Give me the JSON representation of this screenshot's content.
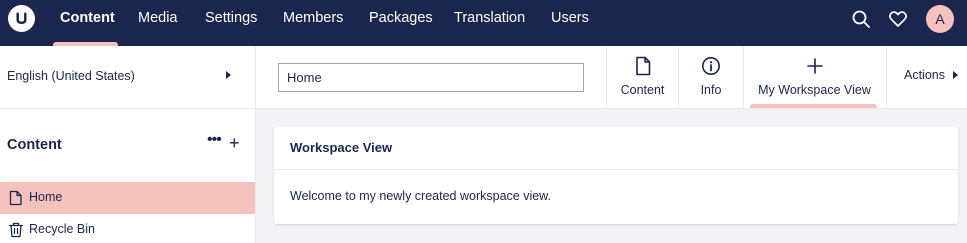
{
  "nav": {
    "items": [
      {
        "label": "Content",
        "active": true
      },
      {
        "label": "Media"
      },
      {
        "label": "Settings"
      },
      {
        "label": "Members"
      },
      {
        "label": "Packages"
      },
      {
        "label": "Translation"
      },
      {
        "label": "Users"
      }
    ],
    "avatar_initial": "A",
    "icons": [
      "umbraco-logo-icon",
      "search-icon",
      "heart-icon"
    ]
  },
  "header": {
    "language": "English (United States)",
    "node_name": "Home",
    "apps": [
      {
        "label": "Content",
        "icon": "document-icon"
      },
      {
        "label": "Info",
        "icon": "info-icon"
      },
      {
        "label": "My Workspace View",
        "icon": "plus-icon",
        "active": true
      }
    ],
    "actions_label": "Actions"
  },
  "sidebar": {
    "title": "Content",
    "items": [
      {
        "label": "Home",
        "icon": "document-icon",
        "active": true
      },
      {
        "label": "Recycle Bin",
        "icon": "trash-icon"
      }
    ]
  },
  "workspace": {
    "title": "Workspace View",
    "body": "Welcome to my newly created workspace view."
  },
  "colors": {
    "nav_bg": "#1b264f",
    "accent": "#f5c1bc",
    "text": "#1b264f",
    "canvas": "#f3f3f5"
  }
}
